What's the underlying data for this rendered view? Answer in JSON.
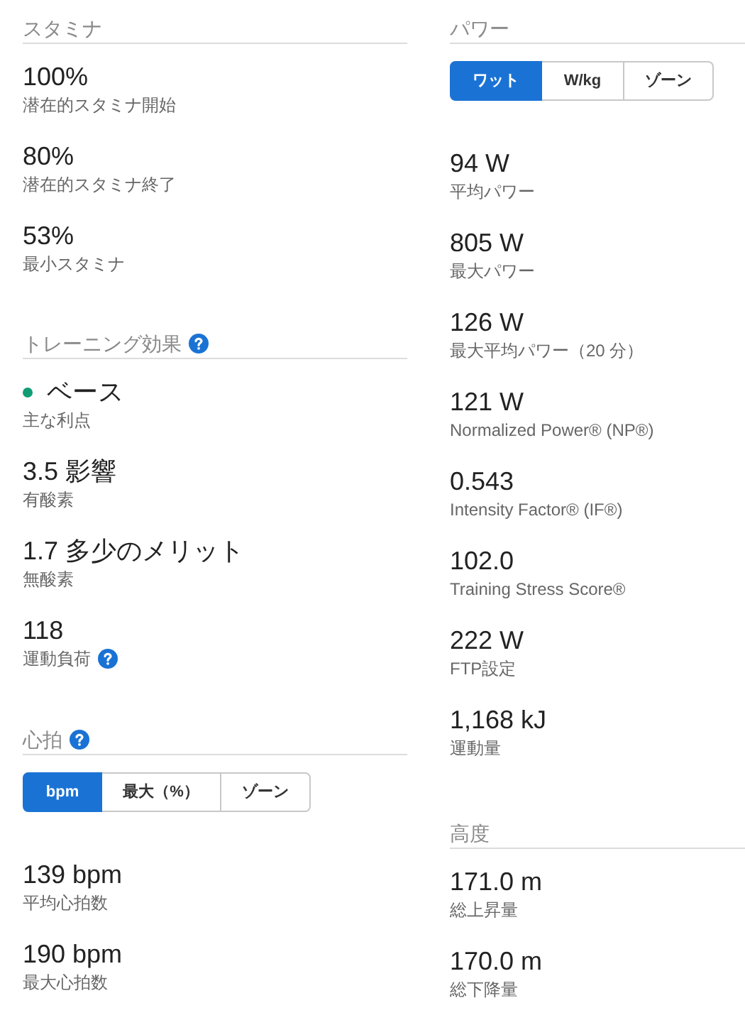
{
  "columns": [
    {
      "sections": [
        {
          "title": "スタミナ",
          "help": false,
          "stats": [
            {
              "value": "100%",
              "label": "潜在的スタミナ開始"
            },
            {
              "value": "80%",
              "label": "潜在的スタミナ終了"
            },
            {
              "value": "53%",
              "label": "最小スタミナ"
            }
          ]
        },
        {
          "title": "トレーニング効果",
          "help": true,
          "stats": [
            {
              "value": "ベース",
              "label": "主な利点",
              "color": "#0f9d76"
            },
            {
              "value": "3.5 影響",
              "label": "有酸素"
            },
            {
              "value": "1.7 多少のメリット",
              "label": "無酸素"
            },
            {
              "value": "118",
              "label": "運動負荷",
              "help": true
            }
          ]
        },
        {
          "title": "心拍",
          "help": true,
          "toggle": [
            {
              "label": "bpm",
              "selected": true
            },
            {
              "label": "最大（%）",
              "selected": false
            },
            {
              "label": "ゾーン",
              "selected": false
            }
          ],
          "stats": [
            {
              "value": "139 bpm",
              "label": "平均心拍数"
            },
            {
              "value": "190 bpm",
              "label": "最大心拍数"
            }
          ]
        }
      ]
    },
    {
      "sections": [
        {
          "title": "パワー",
          "help": false,
          "toggle": [
            {
              "label": "ワット",
              "selected": true
            },
            {
              "label": "W/kg",
              "selected": false
            },
            {
              "label": "ゾーン",
              "selected": false
            }
          ],
          "stats": [
            {
              "value": "94 W",
              "label": "平均パワー"
            },
            {
              "value": "805 W",
              "label": "最大パワー"
            },
            {
              "value": "126 W",
              "label": "最大平均パワー（20 分）"
            },
            {
              "value": "121 W",
              "label": "Normalized Power® (NP®)"
            },
            {
              "value": "0.543",
              "label": "Intensity Factor® (IF®)"
            },
            {
              "value": "102.0",
              "label": "Training Stress Score®"
            },
            {
              "value": "222 W",
              "label": "FTP設定"
            },
            {
              "value": "1,168 kJ",
              "label": "運動量"
            }
          ]
        },
        {
          "title": "高度",
          "help": false,
          "stats": [
            {
              "value": "171.0 m",
              "label": "総上昇量"
            },
            {
              "value": "170.0 m",
              "label": "総下降量"
            }
          ]
        }
      ]
    }
  ]
}
